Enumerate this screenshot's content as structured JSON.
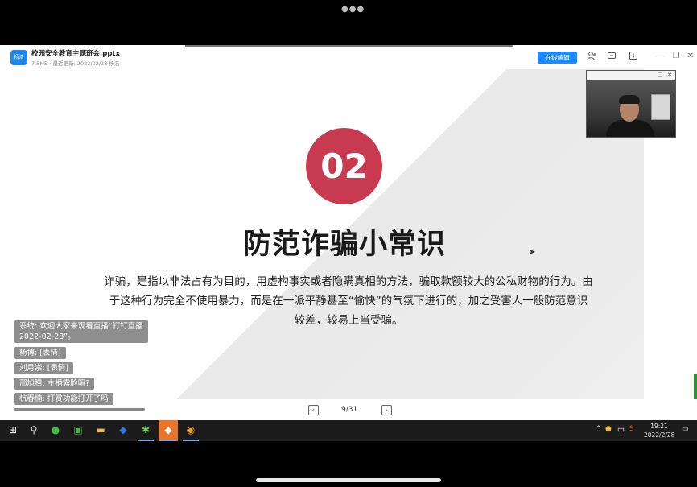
{
  "window": {
    "file_title": "校园安全教育主题班会.pptx",
    "file_meta": "7.5MB · 最近更新: 2022/02/28 杨浩",
    "app_logo_text": "杨浩",
    "edit_label": "在线编辑"
  },
  "slide": {
    "number": "02",
    "title": "防范诈骗小常识",
    "body_line1": "诈骗，是指以非法占有为目的，用虚构事实或者隐瞒真相的方法，骗取款额较大的公私财物的行为。由",
    "body_line2": "于这种行为完全不使用暴力，而是在一派平静甚至“愉快”的气氛下进行的，加之受害人一般防范意识",
    "body_line3": "较差，较易上当受骗。",
    "accent_color": "#c73a4f"
  },
  "chat": {
    "messages": [
      {
        "line1": "系统: 欢迎大家来观看直播“钉钉直播",
        "line2": "2022-02-28”。"
      },
      {
        "text": "杨博: [表情]"
      },
      {
        "text": "刘月崇: [表情]"
      },
      {
        "text": "邢旭腾: 主播露脸嘛?"
      },
      {
        "text": "杭春楠: 打赏功能打开了吗"
      }
    ]
  },
  "pager": {
    "prev_icon": "chevron-left-icon",
    "next_icon": "chevron-right-icon",
    "page_label": "9/31"
  },
  "taskbar": {
    "ime_label": "中",
    "time": "19:21",
    "date": "2022/2/28"
  }
}
